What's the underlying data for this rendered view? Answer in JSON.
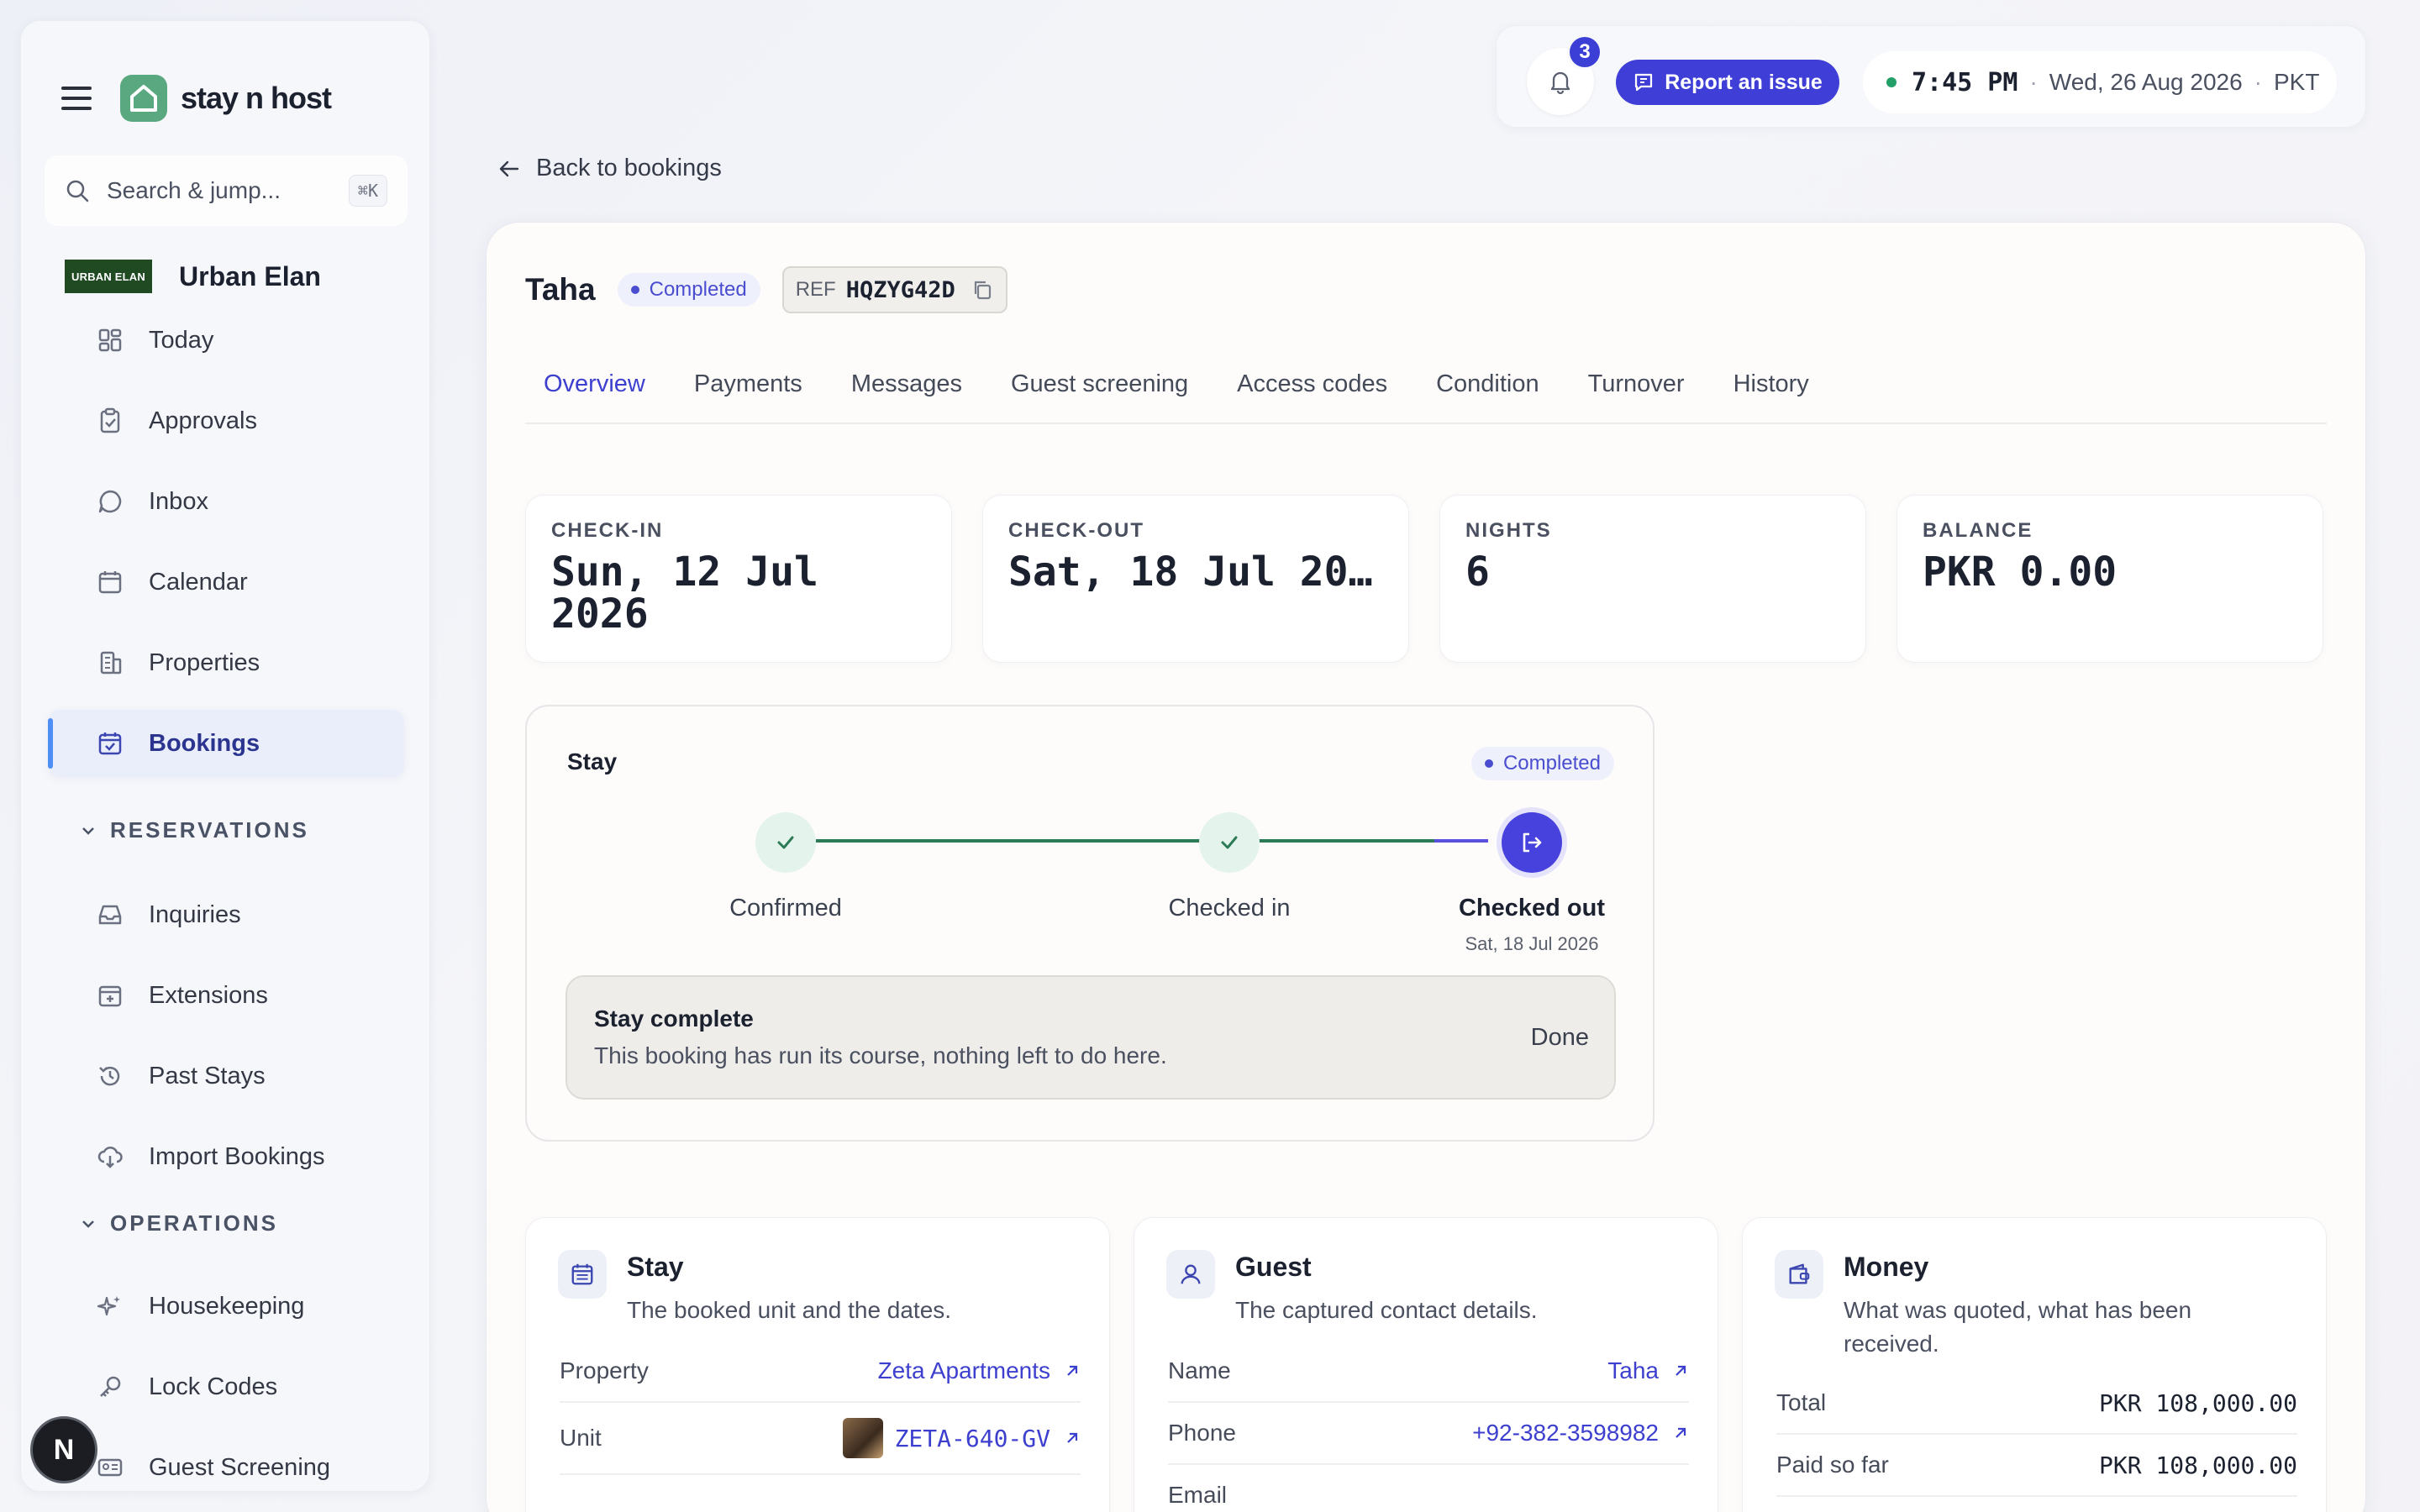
{
  "app": {
    "brand": "stay n host"
  },
  "search": {
    "placeholder": "Search & jump...",
    "shortcut": "⌘K"
  },
  "org": {
    "logo_text": "URBAN ELAN",
    "name": "Urban Elan"
  },
  "sidebar": {
    "items": [
      {
        "label": "Today",
        "icon": "grid-icon"
      },
      {
        "label": "Approvals",
        "icon": "clipboard-check-icon"
      },
      {
        "label": "Inbox",
        "icon": "chat-bubble-icon"
      },
      {
        "label": "Calendar",
        "icon": "calendar-icon"
      },
      {
        "label": "Properties",
        "icon": "building-icon"
      },
      {
        "label": "Bookings",
        "icon": "calendar-check-icon",
        "active": true
      }
    ],
    "reservations_header": "RESERVATIONS",
    "reservations": [
      {
        "label": "Inquiries",
        "icon": "inbox-tray-icon"
      },
      {
        "label": "Extensions",
        "icon": "calendar-plus-icon"
      },
      {
        "label": "Past Stays",
        "icon": "history-icon"
      },
      {
        "label": "Import Bookings",
        "icon": "cloud-download-icon"
      }
    ],
    "operations_header": "OPERATIONS",
    "operations": [
      {
        "label": "Housekeeping",
        "icon": "sparkles-icon"
      },
      {
        "label": "Lock Codes",
        "icon": "key-icon"
      },
      {
        "label": "Guest Screening",
        "icon": "id-card-icon"
      }
    ],
    "user_initial": "N"
  },
  "topbar": {
    "notification_count": "3",
    "report_label": "Report an issue",
    "time": "7:45 PM",
    "date": "Wed, 26 Aug 2026",
    "timezone": "PKT",
    "separator": "·"
  },
  "back_link": "Back to bookings",
  "booking": {
    "guest_name": "Taha",
    "status": "Completed",
    "ref_label": "REF",
    "ref_code": "HQZYG42D"
  },
  "tabs": [
    {
      "label": "Overview",
      "active": true
    },
    {
      "label": "Payments"
    },
    {
      "label": "Messages"
    },
    {
      "label": "Guest screening"
    },
    {
      "label": "Access codes"
    },
    {
      "label": "Condition"
    },
    {
      "label": "Turnover"
    },
    {
      "label": "History"
    }
  ],
  "stats": [
    {
      "label": "CHECK-IN",
      "value": "Sun, 12 Jul 2026"
    },
    {
      "label": "CHECK-OUT",
      "value": "Sat, 18 Jul 20…"
    },
    {
      "label": "NIGHTS",
      "value": "6"
    },
    {
      "label": "BALANCE",
      "value": "PKR 0.00"
    }
  ],
  "stay_progress": {
    "title": "Stay",
    "status": "Completed",
    "steps": [
      {
        "label": "Confirmed",
        "state": "done"
      },
      {
        "label": "Checked in",
        "state": "done"
      },
      {
        "label": "Checked out",
        "state": "current",
        "date": "Sat, 18 Jul 2026"
      }
    ],
    "complete_title": "Stay complete",
    "complete_sub": "This booking has run its course, nothing left to do here.",
    "done_label": "Done"
  },
  "cards": {
    "stay": {
      "title": "Stay",
      "subtitle": "The booked unit and the dates.",
      "rows": [
        {
          "k": "Property",
          "v": "Zeta Apartments"
        },
        {
          "k": "Unit",
          "v": "ZETA-640-GV"
        }
      ]
    },
    "guest": {
      "title": "Guest",
      "subtitle": "The captured contact details.",
      "rows": [
        {
          "k": "Name",
          "v": "Taha"
        },
        {
          "k": "Phone",
          "v": "+92-382-3598982"
        },
        {
          "k": "Email",
          "v": ""
        }
      ]
    },
    "money": {
      "title": "Money",
      "subtitle": "What was quoted, what has been received.",
      "rows": [
        {
          "k": "Total",
          "v": "PKR 108,000.00"
        },
        {
          "k": "Paid so far",
          "v": "PKR 108,000.00"
        }
      ]
    }
  },
  "colors": {
    "accent": "#3f3fd8",
    "success": "#2d7a57",
    "brand": "#5aa880"
  }
}
